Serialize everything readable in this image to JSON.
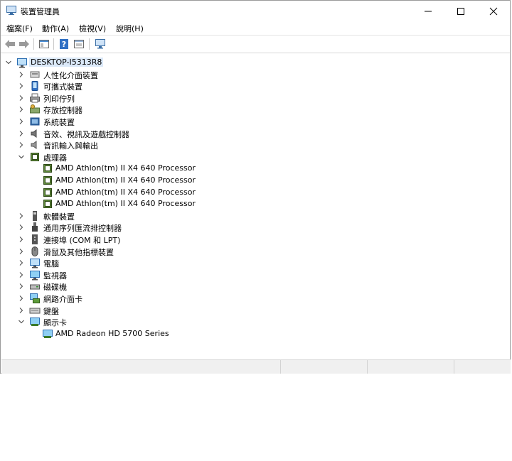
{
  "window": {
    "title": "裝置管理員"
  },
  "menu": [
    "檔案(F)",
    "動作(A)",
    "檢視(V)",
    "說明(H)"
  ],
  "tree": {
    "root": "DESKTOP-I5313R8",
    "categories": [
      {
        "label": "人性化介面裝置",
        "icon": "hid-icon",
        "expanded": false
      },
      {
        "label": "可攜式裝置",
        "icon": "portable-device-icon",
        "expanded": false
      },
      {
        "label": "列印佇列",
        "icon": "printer-icon",
        "expanded": false
      },
      {
        "label": "存放控制器",
        "icon": "storage-controller-icon",
        "expanded": false
      },
      {
        "label": "系統裝置",
        "icon": "system-device-icon",
        "expanded": false
      },
      {
        "label": "音效、視訊及遊戲控制器",
        "icon": "speaker-icon",
        "expanded": false
      },
      {
        "label": "音訊輸入與輸出",
        "icon": "audio-io-icon",
        "expanded": false
      },
      {
        "label": "處理器",
        "icon": "processor-icon",
        "expanded": true,
        "children": [
          "AMD Athlon(tm) II X4 640 Processor",
          "AMD Athlon(tm) II X4 640 Processor",
          "AMD Athlon(tm) II X4 640 Processor",
          "AMD Athlon(tm) II X4 640 Processor"
        ]
      },
      {
        "label": "軟體裝置",
        "icon": "software-device-icon",
        "expanded": false
      },
      {
        "label": "通用序列匯流排控制器",
        "icon": "usb-icon",
        "expanded": false
      },
      {
        "label": "連接埠 (COM 和 LPT)",
        "icon": "port-icon",
        "expanded": false
      },
      {
        "label": "滑鼠及其他指標裝置",
        "icon": "mouse-icon",
        "expanded": false
      },
      {
        "label": "電腦",
        "icon": "computer-icon",
        "expanded": false
      },
      {
        "label": "監視器",
        "icon": "monitor-icon",
        "expanded": false
      },
      {
        "label": "磁碟機",
        "icon": "disk-drive-icon",
        "expanded": false
      },
      {
        "label": "網路介面卡",
        "icon": "network-adapter-icon",
        "expanded": false
      },
      {
        "label": "鍵盤",
        "icon": "keyboard-icon",
        "expanded": false
      },
      {
        "label": "顯示卡",
        "icon": "display-adapter-icon",
        "expanded": true,
        "children": [
          "AMD Radeon HD 5700 Series"
        ]
      }
    ]
  },
  "colors": {
    "accent": "#0078d7",
    "selection": "#dbe9f9"
  }
}
